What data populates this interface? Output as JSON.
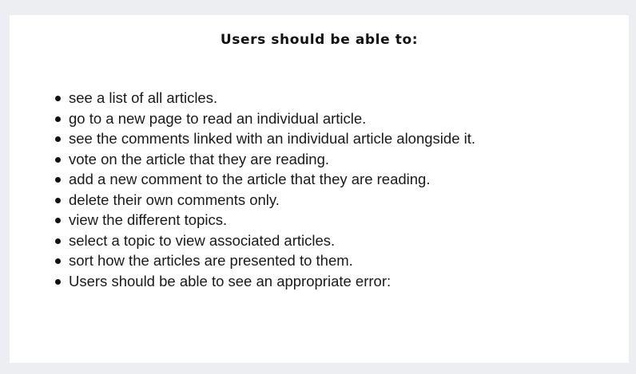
{
  "slide": {
    "title": "Users should be able to:",
    "items": [
      "see a list of all articles.",
      "go to a new page to read an individual article.",
      "see the comments linked with an individual article alongside it.",
      "vote on the article that they are reading.",
      "add a new comment to the article that they are reading.",
      "delete their own comments only.",
      "view the different topics.",
      "select a topic to view associated articles.",
      "sort how the articles are presented to them.",
      "Users should be able to see an appropriate error:"
    ]
  }
}
